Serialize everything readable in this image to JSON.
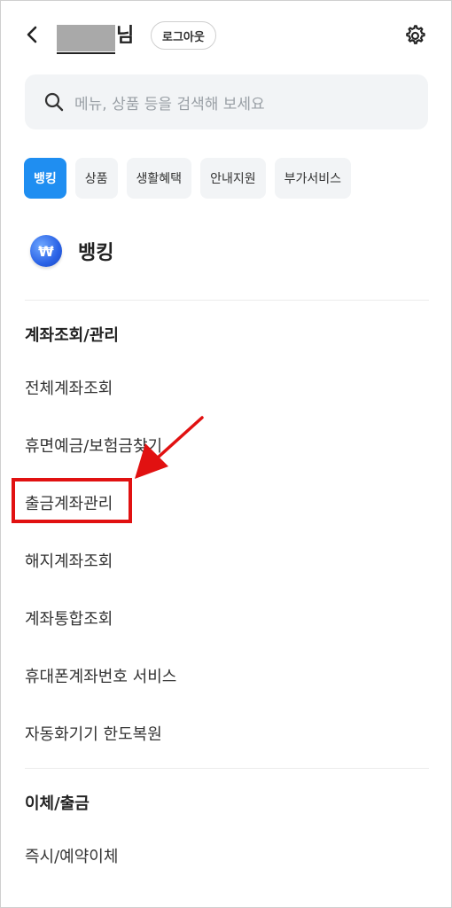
{
  "header": {
    "name_suffix": "님",
    "logout_label": "로그아웃"
  },
  "search": {
    "placeholder": "메뉴, 상품 등을 검색해 보세요"
  },
  "tabs": [
    {
      "label": "뱅킹",
      "active": true
    },
    {
      "label": "상품",
      "active": false
    },
    {
      "label": "생활혜택",
      "active": false
    },
    {
      "label": "안내지원",
      "active": false
    },
    {
      "label": "부가서비스",
      "active": false
    }
  ],
  "section": {
    "title": "뱅킹",
    "coin_symbol": "₩"
  },
  "groups": [
    {
      "title": "계좌조회/관리",
      "items": [
        "전체계좌조회",
        "휴면예금/보험금찾기",
        "출금계좌관리",
        "해지계좌조회",
        "계좌통합조회",
        "휴대폰계좌번호 서비스",
        "자동화기기 한도복원"
      ]
    },
    {
      "title": "이체/출금",
      "items": [
        "즉시/예약이체"
      ]
    }
  ],
  "colors": {
    "accent": "#1f8ef1",
    "highlight": "#e11111"
  }
}
